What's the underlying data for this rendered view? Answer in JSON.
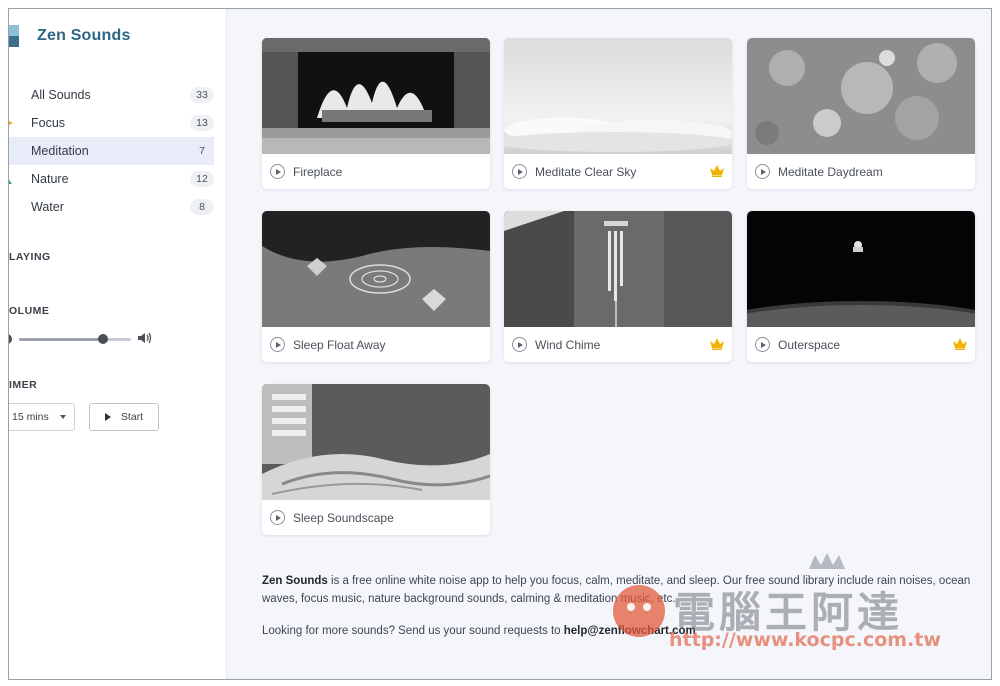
{
  "brand": {
    "title": "Zen Sounds"
  },
  "categories": [
    {
      "label": "All Sounds",
      "count": "33",
      "icon": "sound-icon",
      "color": "#3b6fd8"
    },
    {
      "label": "Focus",
      "count": "13",
      "icon": "star-icon",
      "color": "#f0b400"
    },
    {
      "label": "Meditation",
      "count": "7",
      "icon": "moon-icon",
      "color": "#6b7fd7"
    },
    {
      "label": "Nature",
      "count": "12",
      "icon": "leaf-icon",
      "color": "#2fa56a"
    },
    {
      "label": "Water",
      "count": "8",
      "icon": "drop-icon",
      "color": "#3b6fd8"
    }
  ],
  "active_category": "Meditation",
  "sections": {
    "playing": "LAYING",
    "volume": "OLUME",
    "timer": "IMER"
  },
  "volume": {
    "level": 0.75
  },
  "timer": {
    "selected": "15 mins",
    "start_label": "Start"
  },
  "cards": [
    {
      "title": "Fireplace",
      "premium": false
    },
    {
      "title": "Meditate Clear Sky",
      "premium": true
    },
    {
      "title": "Meditate Daydream",
      "premium": false
    },
    {
      "title": "Sleep Float Away",
      "premium": false
    },
    {
      "title": "Wind Chime",
      "premium": true
    },
    {
      "title": "Outerspace",
      "premium": true
    },
    {
      "title": "Sleep Soundscape",
      "premium": false
    }
  ],
  "footer": {
    "brand": "Zen Sounds",
    "description": " is a free online white noise app to help you focus, calm, meditate, and sleep. Our free sound library include rain noises, ocean waves, focus music, nature background sounds, calming & meditation music, etc.",
    "request_prefix": "Looking for more sounds? Send us your sound requests to ",
    "email": "help@zenflowchart.com"
  },
  "watermark": {
    "text": "電腦王阿達",
    "url": "http://www.kocpc.com.tw"
  },
  "colors": {
    "accent": "#2f6585",
    "crown": "#f0b400",
    "active_bg": "#e8ecf8"
  }
}
